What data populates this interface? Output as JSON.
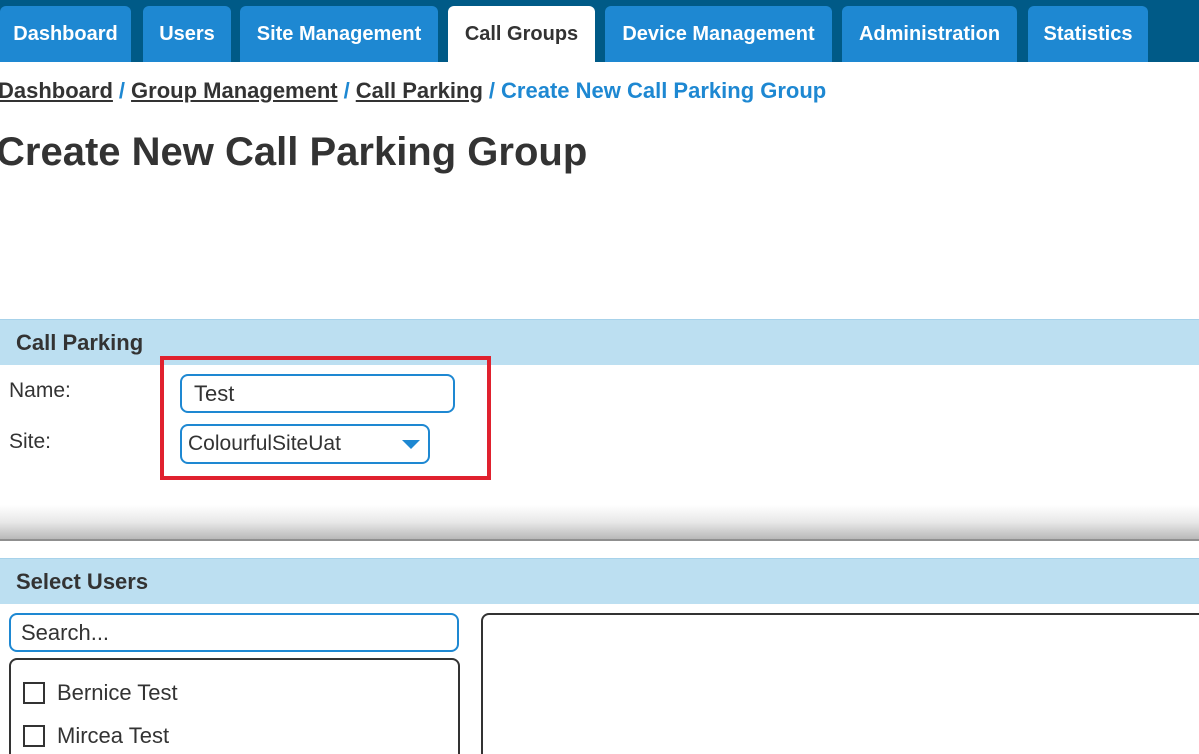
{
  "nav": {
    "tabs": [
      {
        "label": "Dashboard"
      },
      {
        "label": "Users"
      },
      {
        "label": "Site Management"
      },
      {
        "label": "Call Groups",
        "active": true
      },
      {
        "label": "Device Management"
      },
      {
        "label": "Administration"
      },
      {
        "label": "Statistics"
      }
    ]
  },
  "breadcrumb": {
    "items": [
      "Dashboard",
      "Group Management",
      "Call Parking"
    ],
    "separator": "/",
    "current": "Create New Call Parking Group"
  },
  "page_title": "Create New Call Parking Group",
  "call_parking": {
    "header": "Call Parking",
    "name_label": "Name:",
    "name_value": "Test",
    "site_label": "Site:",
    "site_value": "ColourfulSiteUat"
  },
  "select_users": {
    "header": "Select Users",
    "search_placeholder": "Search...",
    "users": [
      "Bernice Test",
      "Mircea Test"
    ]
  },
  "colors": {
    "nav_bg": "#005a87",
    "tab_bg": "#1e88d2",
    "section_header_bg": "#bcdff1",
    "highlight": "#e0212e",
    "accent": "#1e88d2"
  },
  "icons": {
    "site_dropdown": "chevron-down-icon",
    "user_checkbox": "checkbox-icon"
  }
}
